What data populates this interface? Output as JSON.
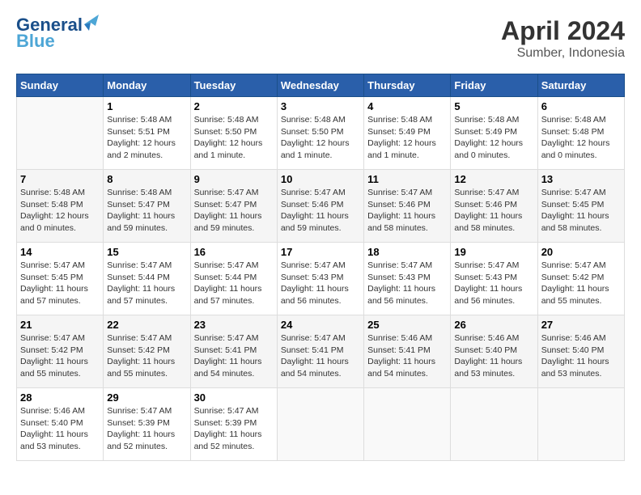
{
  "header": {
    "logo_line1": "General",
    "logo_line2": "Blue",
    "month_year": "April 2024",
    "location": "Sumber, Indonesia"
  },
  "weekdays": [
    "Sunday",
    "Monday",
    "Tuesday",
    "Wednesday",
    "Thursday",
    "Friday",
    "Saturday"
  ],
  "weeks": [
    [
      {
        "day": "",
        "info": ""
      },
      {
        "day": "1",
        "info": "Sunrise: 5:48 AM\nSunset: 5:51 PM\nDaylight: 12 hours\nand 2 minutes."
      },
      {
        "day": "2",
        "info": "Sunrise: 5:48 AM\nSunset: 5:50 PM\nDaylight: 12 hours\nand 1 minute."
      },
      {
        "day": "3",
        "info": "Sunrise: 5:48 AM\nSunset: 5:50 PM\nDaylight: 12 hours\nand 1 minute."
      },
      {
        "day": "4",
        "info": "Sunrise: 5:48 AM\nSunset: 5:49 PM\nDaylight: 12 hours\nand 1 minute."
      },
      {
        "day": "5",
        "info": "Sunrise: 5:48 AM\nSunset: 5:49 PM\nDaylight: 12 hours\nand 0 minutes."
      },
      {
        "day": "6",
        "info": "Sunrise: 5:48 AM\nSunset: 5:48 PM\nDaylight: 12 hours\nand 0 minutes."
      }
    ],
    [
      {
        "day": "7",
        "info": "Sunrise: 5:48 AM\nSunset: 5:48 PM\nDaylight: 12 hours\nand 0 minutes."
      },
      {
        "day": "8",
        "info": "Sunrise: 5:48 AM\nSunset: 5:47 PM\nDaylight: 11 hours\nand 59 minutes."
      },
      {
        "day": "9",
        "info": "Sunrise: 5:47 AM\nSunset: 5:47 PM\nDaylight: 11 hours\nand 59 minutes."
      },
      {
        "day": "10",
        "info": "Sunrise: 5:47 AM\nSunset: 5:46 PM\nDaylight: 11 hours\nand 59 minutes."
      },
      {
        "day": "11",
        "info": "Sunrise: 5:47 AM\nSunset: 5:46 PM\nDaylight: 11 hours\nand 58 minutes."
      },
      {
        "day": "12",
        "info": "Sunrise: 5:47 AM\nSunset: 5:46 PM\nDaylight: 11 hours\nand 58 minutes."
      },
      {
        "day": "13",
        "info": "Sunrise: 5:47 AM\nSunset: 5:45 PM\nDaylight: 11 hours\nand 58 minutes."
      }
    ],
    [
      {
        "day": "14",
        "info": "Sunrise: 5:47 AM\nSunset: 5:45 PM\nDaylight: 11 hours\nand 57 minutes."
      },
      {
        "day": "15",
        "info": "Sunrise: 5:47 AM\nSunset: 5:44 PM\nDaylight: 11 hours\nand 57 minutes."
      },
      {
        "day": "16",
        "info": "Sunrise: 5:47 AM\nSunset: 5:44 PM\nDaylight: 11 hours\nand 57 minutes."
      },
      {
        "day": "17",
        "info": "Sunrise: 5:47 AM\nSunset: 5:43 PM\nDaylight: 11 hours\nand 56 minutes."
      },
      {
        "day": "18",
        "info": "Sunrise: 5:47 AM\nSunset: 5:43 PM\nDaylight: 11 hours\nand 56 minutes."
      },
      {
        "day": "19",
        "info": "Sunrise: 5:47 AM\nSunset: 5:43 PM\nDaylight: 11 hours\nand 56 minutes."
      },
      {
        "day": "20",
        "info": "Sunrise: 5:47 AM\nSunset: 5:42 PM\nDaylight: 11 hours\nand 55 minutes."
      }
    ],
    [
      {
        "day": "21",
        "info": "Sunrise: 5:47 AM\nSunset: 5:42 PM\nDaylight: 11 hours\nand 55 minutes."
      },
      {
        "day": "22",
        "info": "Sunrise: 5:47 AM\nSunset: 5:42 PM\nDaylight: 11 hours\nand 55 minutes."
      },
      {
        "day": "23",
        "info": "Sunrise: 5:47 AM\nSunset: 5:41 PM\nDaylight: 11 hours\nand 54 minutes."
      },
      {
        "day": "24",
        "info": "Sunrise: 5:47 AM\nSunset: 5:41 PM\nDaylight: 11 hours\nand 54 minutes."
      },
      {
        "day": "25",
        "info": "Sunrise: 5:46 AM\nSunset: 5:41 PM\nDaylight: 11 hours\nand 54 minutes."
      },
      {
        "day": "26",
        "info": "Sunrise: 5:46 AM\nSunset: 5:40 PM\nDaylight: 11 hours\nand 53 minutes."
      },
      {
        "day": "27",
        "info": "Sunrise: 5:46 AM\nSunset: 5:40 PM\nDaylight: 11 hours\nand 53 minutes."
      }
    ],
    [
      {
        "day": "28",
        "info": "Sunrise: 5:46 AM\nSunset: 5:40 PM\nDaylight: 11 hours\nand 53 minutes."
      },
      {
        "day": "29",
        "info": "Sunrise: 5:47 AM\nSunset: 5:39 PM\nDaylight: 11 hours\nand 52 minutes."
      },
      {
        "day": "30",
        "info": "Sunrise: 5:47 AM\nSunset: 5:39 PM\nDaylight: 11 hours\nand 52 minutes."
      },
      {
        "day": "",
        "info": ""
      },
      {
        "day": "",
        "info": ""
      },
      {
        "day": "",
        "info": ""
      },
      {
        "day": "",
        "info": ""
      }
    ]
  ]
}
